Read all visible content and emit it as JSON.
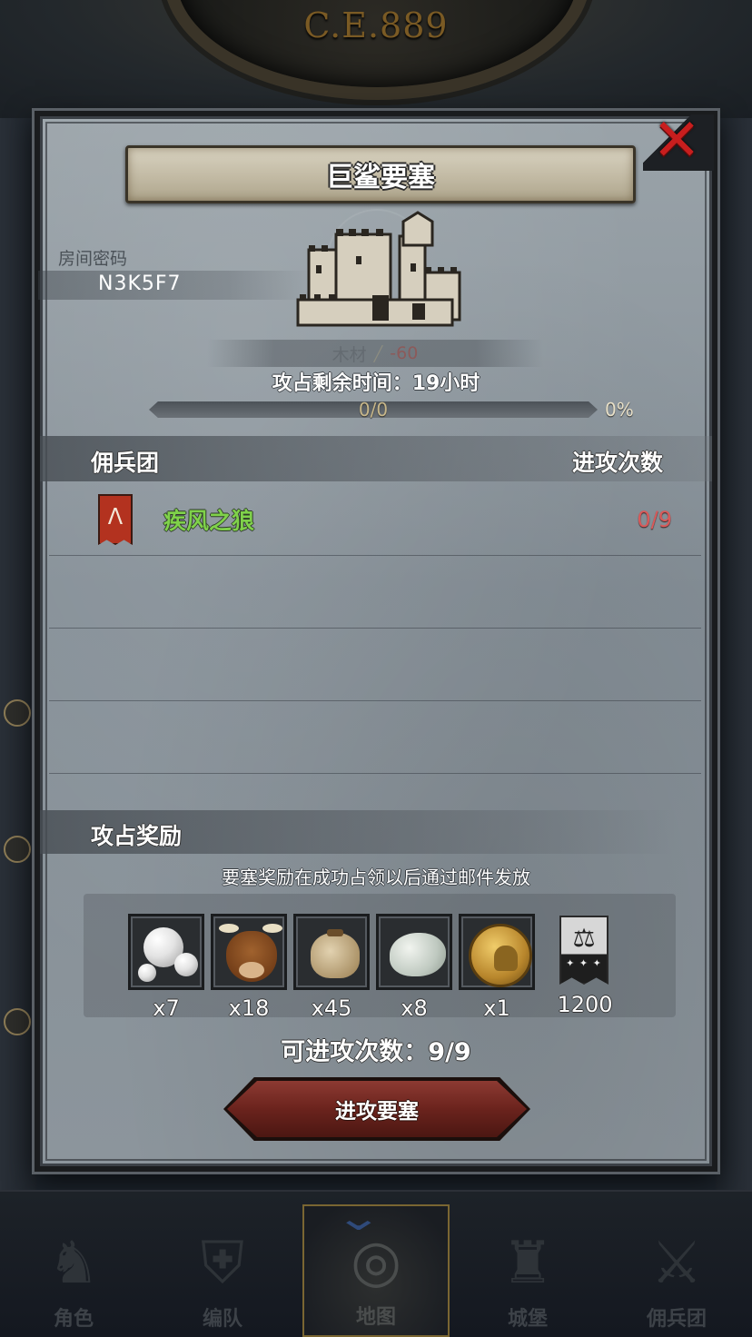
{
  "header": {
    "era": "C.E.889"
  },
  "modal": {
    "title": "巨鲨要塞",
    "room_label": "房间密码",
    "room_code": "N3K5F7",
    "cost": {
      "label": "木材",
      "icon": "wood-icon",
      "value": "-60"
    },
    "occupation_time": "攻占剩余时间：19小时",
    "progress": {
      "text": "0/0",
      "percent": "0%",
      "fraction": 0
    },
    "table": {
      "col_left": "佣兵团",
      "col_right": "进攻次数",
      "rows": [
        {
          "name": "疾风之狼",
          "count": "0/9",
          "icon": "wolf-banner-icon",
          "color": "#7fd14a"
        }
      ]
    },
    "rewards": {
      "title": "攻占奖励",
      "note": "要塞奖励在成功占领以后通过邮件发放",
      "items": [
        {
          "icon": "pearl-icon",
          "qty": "x7"
        },
        {
          "icon": "ox-icon",
          "qty": "x18"
        },
        {
          "icon": "grain-sack-icon",
          "qty": "x45"
        },
        {
          "icon": "stone-icon",
          "qty": "x8"
        },
        {
          "icon": "knight-coin-icon",
          "qty": "x1"
        },
        {
          "icon": "merit-banner-icon",
          "qty": "1200"
        }
      ]
    },
    "attempts": "可进攻次数：9/9",
    "attack_button": "进攻要塞"
  },
  "nav": {
    "items": [
      {
        "label": "角色",
        "icon": "knight-icon"
      },
      {
        "label": "编队",
        "icon": "helmet-icon"
      },
      {
        "label": "地图",
        "icon": "map-icon",
        "active": true
      },
      {
        "label": "城堡",
        "icon": "castle-icon"
      },
      {
        "label": "佣兵团",
        "icon": "mercenary-icon"
      }
    ]
  },
  "colors": {
    "accent": "#c9a14a",
    "danger": "#d95a5a",
    "ally": "#7fd14a",
    "button": "#6b231d"
  }
}
